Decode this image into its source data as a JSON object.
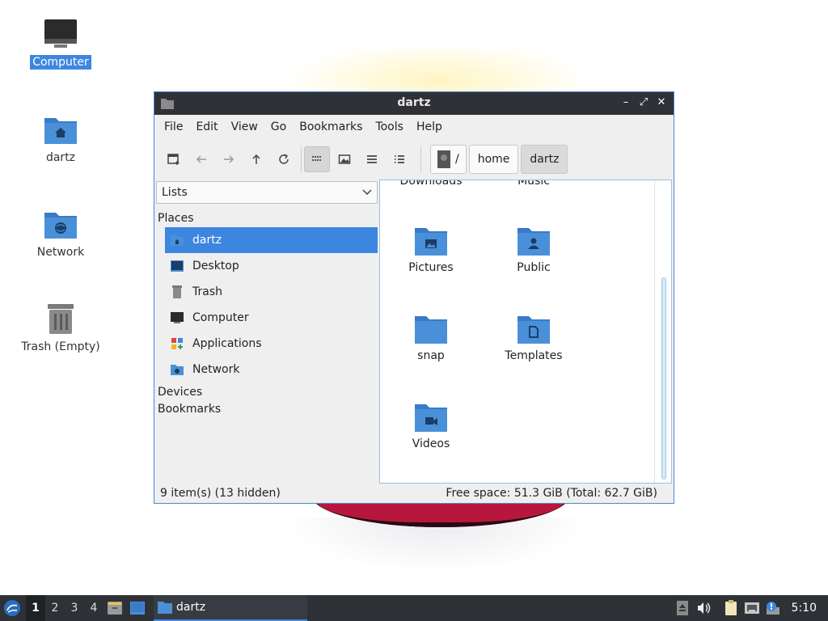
{
  "colors": {
    "accent": "#3d86e0",
    "folder_blue": "#4a90d9",
    "taskbar_bg": "#2e3136",
    "titlebar_bg": "#2f3136"
  },
  "desktop": {
    "icons": [
      {
        "label": "Computer",
        "icon": "computer-icon",
        "selected": true
      },
      {
        "label": "dartz",
        "icon": "home-folder-icon"
      },
      {
        "label": "Network",
        "icon": "network-folder-icon"
      },
      {
        "label": "Trash (Empty)",
        "icon": "trash-icon"
      }
    ]
  },
  "window": {
    "title": "dartz",
    "controls": {
      "minimize": "–",
      "maximize": "⤢",
      "close": "✕"
    },
    "menu": [
      "File",
      "Edit",
      "View",
      "Go",
      "Bookmarks",
      "Tools",
      "Help"
    ],
    "toolbar": {
      "buttons": [
        "new-tab-icon",
        "back-icon",
        "forward-icon",
        "up-icon",
        "reload-icon",
        "icon-view-icon",
        "thumbnail-view-icon",
        "compact-view-icon",
        "detailed-list-icon"
      ],
      "active_view": "icon-view-icon"
    },
    "path": {
      "root": "/",
      "segments": [
        "home",
        "dartz"
      ],
      "current": "dartz"
    },
    "sidepane": {
      "mode": "Lists",
      "sections": {
        "places": "Places",
        "devices": "Devices",
        "bookmarks": "Bookmarks"
      },
      "places": [
        {
          "label": "dartz",
          "icon": "home-folder-icon",
          "selected": true
        },
        {
          "label": "Desktop",
          "icon": "desktop-icon"
        },
        {
          "label": "Trash",
          "icon": "trash-icon"
        },
        {
          "label": "Computer",
          "icon": "computer-icon"
        },
        {
          "label": "Applications",
          "icon": "applications-icon"
        },
        {
          "label": "Network",
          "icon": "network-folder-icon"
        }
      ]
    },
    "files": {
      "partial_top": [
        "Downloads",
        "Music"
      ],
      "items": [
        {
          "label": "Pictures",
          "icon": "pictures-folder-icon"
        },
        {
          "label": "Public",
          "icon": "public-folder-icon"
        },
        {
          "label": "snap",
          "icon": "folder-icon"
        },
        {
          "label": "Templates",
          "icon": "templates-folder-icon"
        },
        {
          "label": "Videos",
          "icon": "videos-folder-icon"
        }
      ]
    },
    "status": {
      "items": "9 item(s) (13 hidden)",
      "space": "Free space: 51.3 GiB (Total: 62.7 GiB)"
    }
  },
  "taskbar": {
    "workspaces": [
      "1",
      "2",
      "3",
      "4"
    ],
    "current_workspace": "1",
    "launchers": [
      "file-manager-icon",
      "desktop-icon"
    ],
    "task": {
      "label": "dartz",
      "icon": "folder-icon"
    },
    "tray": [
      "eject-icon",
      "volume-icon",
      "clipboard-icon",
      "network-wired-icon",
      "update-notifier-icon"
    ],
    "clock": "5:10"
  }
}
